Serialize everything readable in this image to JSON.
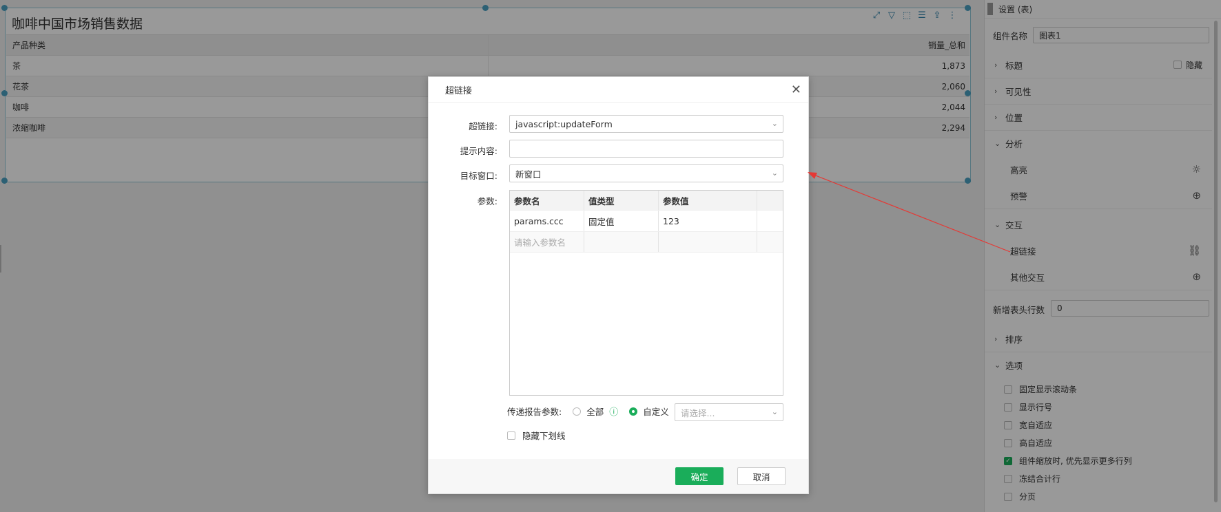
{
  "widget": {
    "title": "咖啡中国市场销售数据",
    "columns": [
      "产品种类",
      "销量_总和"
    ],
    "rows": [
      {
        "name": "茶",
        "value": "1,873"
      },
      {
        "name": "花茶",
        "value": "2,060"
      },
      {
        "name": "咖啡",
        "value": "2,044"
      },
      {
        "name": "浓缩咖啡",
        "value": "2,294"
      }
    ]
  },
  "panel": {
    "header": "设置 (表)",
    "component_name_label": "组件名称",
    "component_name_value": "图表1",
    "title_section": "标题",
    "hide_label": "隐藏",
    "visibility_section": "可见性",
    "position_section": "位置",
    "analysis_section": "分析",
    "highlight": "高亮",
    "warning": "预警",
    "interaction_section": "交互",
    "hyperlink": "超链接",
    "other_interaction": "其他交互",
    "new_header_rows_label": "新增表头行数",
    "new_header_rows_value": "0",
    "sort_section": "排序",
    "options_section": "选项",
    "options": [
      {
        "label": "固定显示滚动条",
        "checked": false
      },
      {
        "label": "显示行号",
        "checked": false
      },
      {
        "label": "宽自适应",
        "checked": false
      },
      {
        "label": "高自适应",
        "checked": false
      },
      {
        "label": "组件缩放时, 优先显示更多行列",
        "checked": true
      },
      {
        "label": "冻结合计行",
        "checked": false
      },
      {
        "label": "分页",
        "checked": false
      }
    ]
  },
  "dialog": {
    "title": "超链接",
    "link_label": "超链接:",
    "link_value": "javascript:updateForm",
    "tooltip_label": "提示内容:",
    "tooltip_value": "",
    "target_label": "目标窗口:",
    "target_value": "新窗口",
    "params_label": "参数:",
    "param_columns": [
      "参数名",
      "值类型",
      "参数值"
    ],
    "param_rows": [
      {
        "name": "params.ccc",
        "type": "固定值",
        "value": "123"
      }
    ],
    "param_name_placeholder": "请输入参数名",
    "pass_params_label": "传递报告参数:",
    "all_label": "全部",
    "custom_label": "自定义",
    "select_placeholder": "请选择...",
    "hide_underline_label": "隐藏下划线",
    "ok_label": "确定",
    "cancel_label": "取消"
  },
  "colors": {
    "accent": "#1aad5a",
    "selection": "#4aa0c2",
    "annotation_arrow": "#e53935"
  }
}
